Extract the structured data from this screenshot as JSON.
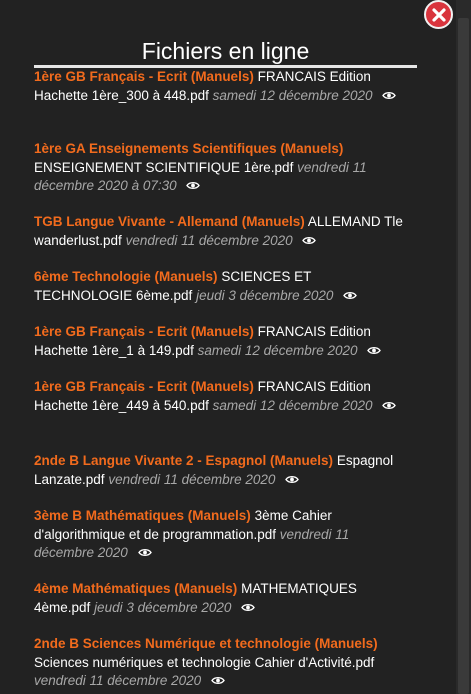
{
  "title": "Fichiers en ligne",
  "files": [
    {
      "category": "1ère GB Français - Ecrit (Manuels)",
      "name": "FRANCAIS Edition Hachette 1ère_300 à 448.pdf",
      "date": "samedi 12 décembre 2020"
    },
    {
      "category": "1ère GA Enseignements Scientifiques (Manuels)",
      "name": "ENSEIGNEMENT SCIENTIFIQUE 1ère.pdf",
      "date": "vendredi 11 décembre 2020 à 07:30"
    },
    {
      "category": "TGB Langue Vivante - Allemand (Manuels)",
      "name": "ALLEMAND Tle wanderlust.pdf",
      "date": "vendredi 11 décembre 2020"
    },
    {
      "category": "6ème Technologie (Manuels)",
      "name": "SCIENCES ET TECHNOLOGIE 6ème.pdf",
      "date": "jeudi 3 décembre 2020"
    },
    {
      "category": "1ère GB Français - Ecrit (Manuels)",
      "name": "FRANCAIS Edition Hachette 1ère_1 à 149.pdf",
      "date": "samedi 12 décembre 2020"
    },
    {
      "category": "1ère GB Français - Ecrit (Manuels)",
      "name": "FRANCAIS Edition Hachette 1ère_449 à 540.pdf",
      "date": "samedi 12 décembre 2020"
    },
    {
      "category": "2nde B Langue Vivante 2 - Espagnol (Manuels)",
      "name": "Espagnol Lanzate.pdf",
      "date": "vendredi 11 décembre 2020"
    },
    {
      "category": "3ème B Mathématiques (Manuels)",
      "name": "3ème Cahier d'algorithmique et de programmation.pdf",
      "date": "vendredi 11 décembre 2020"
    },
    {
      "category": "4ème Mathématiques (Manuels)",
      "name": "MATHEMATIQUES 4ème.pdf",
      "date": "jeudi 3 décembre 2020"
    },
    {
      "category": "2nde B Sciences Numérique et technologie (Manuels)",
      "name": "Sciences numériques et technologie Cahier d'Activité.pdf",
      "date": "vendredi 11 décembre 2020"
    }
  ],
  "icons": {
    "close": "close-icon",
    "view": "eye-icon"
  },
  "colors": {
    "category": "#f26b1d",
    "date": "#a8a8a8",
    "close": "#d9343d",
    "background": "#222222"
  }
}
